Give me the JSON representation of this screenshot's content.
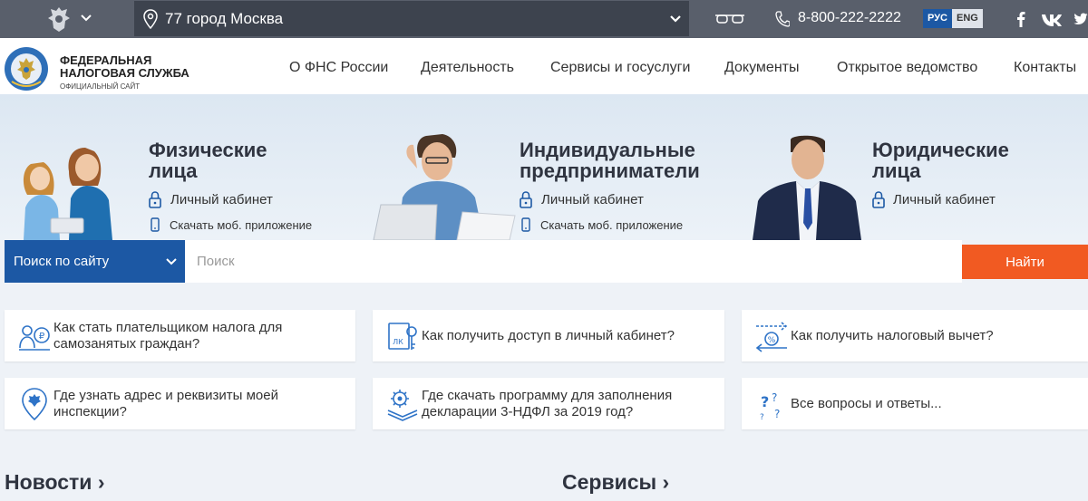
{
  "topbar": {
    "region_text": "77 город Москва",
    "phone": "8-800-222-2222",
    "lang_ru": "РУС",
    "lang_en": "ENG"
  },
  "header": {
    "logo_line1": "ФЕДЕРАЛЬНАЯ",
    "logo_line2": "НАЛОГОВАЯ СЛУЖБА",
    "logo_line3": "ОФИЦИАЛЬНЫЙ САЙТ",
    "nav": [
      "О ФНС России",
      "Деятельность",
      "Сервисы и госуслуги",
      "Документы",
      "Открытое ведомство",
      "Контакты"
    ]
  },
  "hero": {
    "cards": [
      {
        "title_l1": "Физические",
        "title_l2": "лица",
        "cabinet": "Личный кабинет",
        "app": "Скачать моб. приложение"
      },
      {
        "title_l1": "Индивидуальные",
        "title_l2": "предприниматели",
        "cabinet": "Личный кабинет",
        "app": "Скачать моб. приложение"
      },
      {
        "title_l1": "Юридические",
        "title_l2": "лица",
        "cabinet": "Личный кабинет"
      }
    ]
  },
  "search": {
    "selector": "Поиск по сайту",
    "placeholder": "Поиск",
    "button": "Найти"
  },
  "faq": [
    {
      "l1": "Как стать плательщиком налога для",
      "l2": "самозанятых граждан?"
    },
    {
      "l1": "Как получить доступ в личный кабинет?"
    },
    {
      "l1": "Как получить налоговый вычет?"
    },
    {
      "l1": "Где узнать адрес и реквизиты моей",
      "l2": "инспекции?"
    },
    {
      "l1": "Где скачать программу для заполнения",
      "l2": "декларации 3-НДФЛ за 2019 год?"
    },
    {
      "l1": "Все вопросы и ответы..."
    }
  ],
  "sections": {
    "news": "Новости ›",
    "services": "Сервисы ›"
  },
  "colors": {
    "topbar": "#595f6b",
    "region_bg": "#3d434e",
    "brand_blue": "#1c58a4",
    "search_button": "#f15a22",
    "icon_blue": "#2e73c7"
  }
}
